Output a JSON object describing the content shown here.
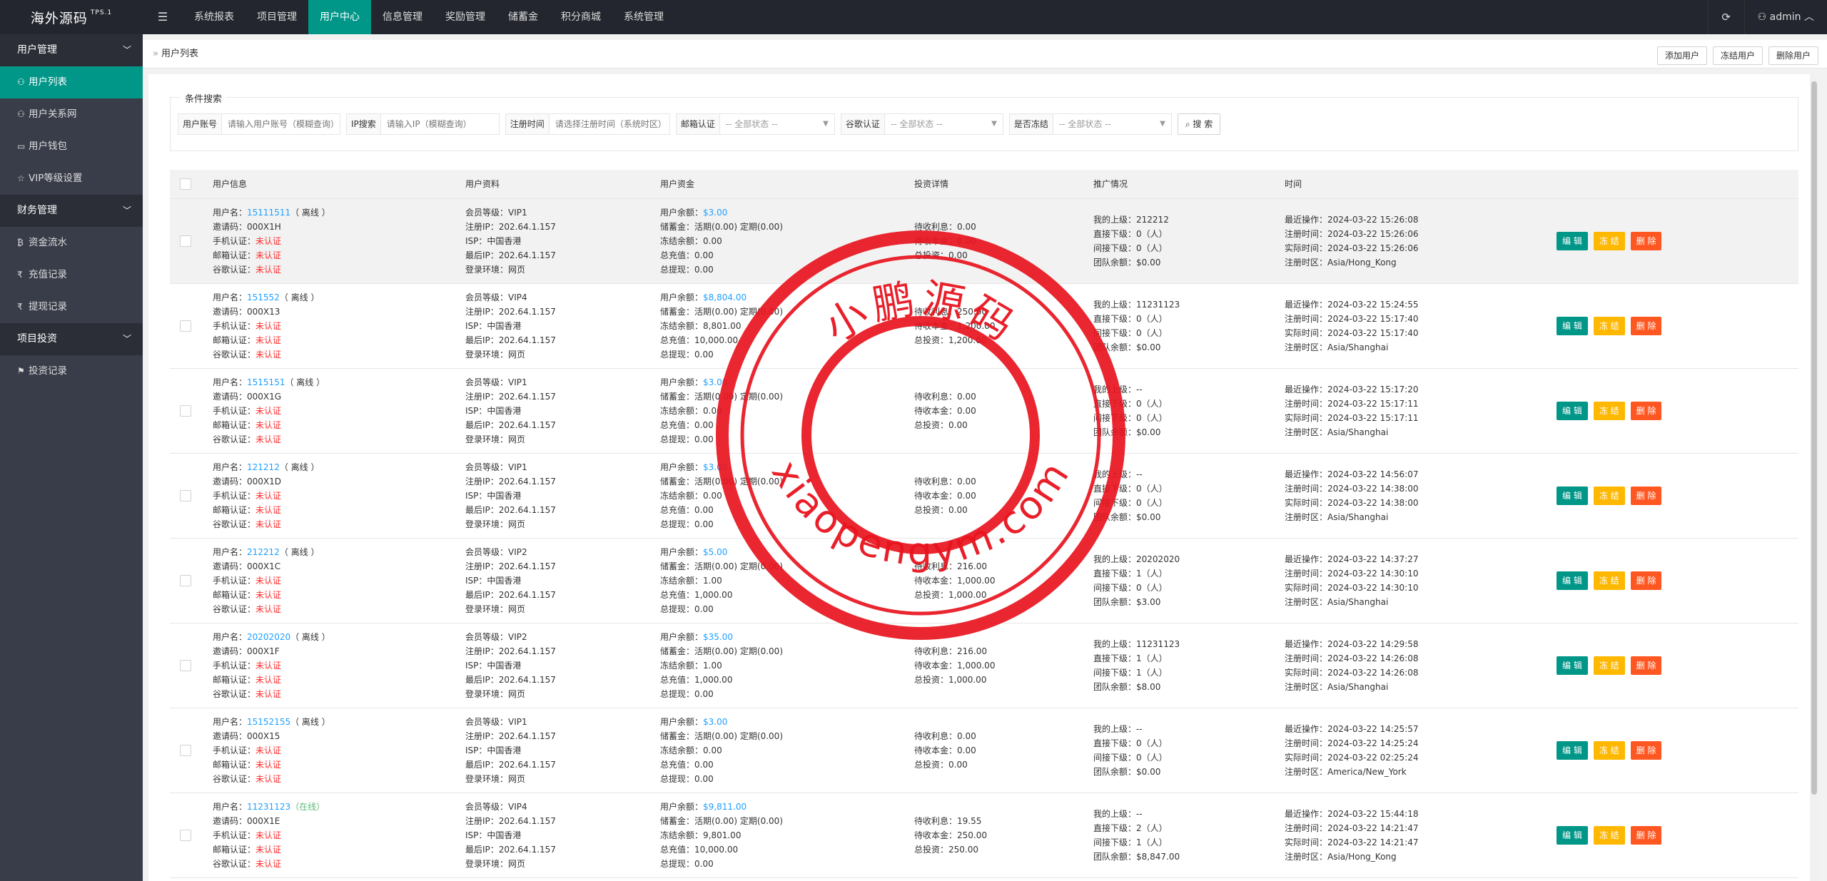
{
  "app": {
    "logo": "海外源码",
    "version": "TPS.1"
  },
  "topnav": {
    "menu_icon": "menu-icon",
    "items": [
      "系统报表",
      "项目管理",
      "用户中心",
      "信息管理",
      "奖励管理",
      "储蓄金",
      "积分商城",
      "系统管理"
    ],
    "active": "用户中心",
    "user": "admin",
    "refresh_icon": "refresh-icon"
  },
  "sidebar": {
    "groups": [
      {
        "label": "用户管理",
        "items": [
          {
            "label": "用户列表",
            "icon": "user-icon",
            "active": true
          },
          {
            "label": "用户关系网",
            "icon": "user-network-icon"
          },
          {
            "label": "用户钱包",
            "icon": "wallet-icon"
          },
          {
            "label": "VIP等级设置",
            "icon": "star-icon"
          }
        ]
      },
      {
        "label": "财务管理",
        "items": [
          {
            "label": "资金流水",
            "icon": "bitcoin-icon"
          },
          {
            "label": "充值记录",
            "icon": "rupee-icon"
          },
          {
            "label": "提现记录",
            "icon": "rupee-icon"
          }
        ]
      },
      {
        "label": "项目投资",
        "items": [
          {
            "label": "投资记录",
            "icon": "flag-icon"
          }
        ]
      }
    ]
  },
  "breadcrumb": {
    "sep": "»",
    "label": "用户列表"
  },
  "actions": {
    "add": "添加用户",
    "freeze": "冻结用户",
    "delete": "删除用户"
  },
  "search": {
    "legend": "条件搜索",
    "account": {
      "label": "用户账号",
      "placeholder": "请输入用户账号（模糊查询）"
    },
    "ip": {
      "label": "IP搜索",
      "placeholder": "请输入IP（模糊查询）"
    },
    "reg_time": {
      "label": "注册时间",
      "placeholder": "请选择注册时间（系统时区）"
    },
    "email_auth": {
      "label": "邮箱认证",
      "value": "-- 全部状态 --"
    },
    "google_auth": {
      "label": "谷歌认证",
      "value": "-- 全部状态 --"
    },
    "frozen": {
      "label": "是否冻结",
      "value": "-- 全部状态 --"
    },
    "button": "搜 索"
  },
  "table": {
    "headers": [
      "用户信息",
      "用户资料",
      "用户资金",
      "投资详情",
      "推广情况",
      "时间"
    ],
    "ops": {
      "edit": "编 辑",
      "freeze": "冻 结",
      "delete": "删 除"
    },
    "labels": {
      "username": "用户名：",
      "invite": "邀请码：",
      "phone": "手机认证：",
      "email": "邮箱认证：",
      "google": "谷歌认证：",
      "vip": "会员等级：",
      "reg_ip": "注册IP：",
      "isp": "ISP：",
      "last_ip": "最后IP：",
      "env": "登录环境：",
      "balance": "用户余额：",
      "savings": "储蓄金：",
      "frozen": "冻结余额：",
      "recharge": "总充值：",
      "withdraw": "总提现：",
      "pending_interest": "待收利息：",
      "pending_principal": "待收本金：",
      "total_invest": "总投资：",
      "superior": "我的上级：",
      "direct": "直接下级：",
      "indirect": "间接下级：",
      "team": "团队余额：",
      "last_op": "最近操作：",
      "reg_time": "注册时间：",
      "real_time": "实际时间：",
      "reg_tz": "注册时区："
    },
    "rows": [
      {
        "username": "15111511",
        "status": "（ 离线 ）",
        "online": false,
        "invite": "000X1H",
        "phone": "未认证",
        "email": "未认证",
        "google": "未认证",
        "vip": "VIP1",
        "reg_ip": "202.64.1.157",
        "isp": "中国香港",
        "last_ip": "202.64.1.157",
        "env": "网页",
        "balance": "$3.00",
        "savings": "活期(0.00) 定期(0.00)",
        "frozen": "0.00",
        "recharge": "0.00",
        "withdraw": "0.00",
        "pending_interest": "0.00",
        "pending_principal": "0.00",
        "total_invest": "0.00",
        "superior": "212212",
        "direct": "0（人）",
        "indirect": "0（人）",
        "team": "$0.00",
        "last_op": "2024-03-22 15:26:08",
        "reg_time": "2024-03-22 15:26:06",
        "real_time": "2024-03-22 15:26:06",
        "reg_tz": "Asia/Hong_Kong"
      },
      {
        "username": "151552",
        "status": "（ 离线 ）",
        "online": false,
        "invite": "000X13",
        "phone": "未认证",
        "email": "未认证",
        "google": "未认证",
        "vip": "VIP4",
        "reg_ip": "202.64.1.157",
        "isp": "中国香港",
        "last_ip": "202.64.1.157",
        "env": "网页",
        "balance": "$8,804.00",
        "savings": "活期(0.00) 定期(0.00)",
        "frozen": "8,801.00",
        "recharge": "10,000.00",
        "withdraw": "0.00",
        "pending_interest": "250.00",
        "pending_principal": "1,200.00",
        "total_invest": "1,200.00",
        "superior": "11231123",
        "direct": "0（人）",
        "indirect": "0（人）",
        "team": "$0.00",
        "last_op": "2024-03-22 15:24:55",
        "reg_time": "2024-03-22 15:17:40",
        "real_time": "2024-03-22 15:17:40",
        "reg_tz": "Asia/Shanghai"
      },
      {
        "username": "1515151",
        "status": "（ 离线 ）",
        "online": false,
        "invite": "000X1G",
        "phone": "未认证",
        "email": "未认证",
        "google": "未认证",
        "vip": "VIP1",
        "reg_ip": "202.64.1.157",
        "isp": "中国香港",
        "last_ip": "202.64.1.157",
        "env": "网页",
        "balance": "$3.00",
        "savings": "活期(0.00) 定期(0.00)",
        "frozen": "0.00",
        "recharge": "0.00",
        "withdraw": "0.00",
        "pending_interest": "0.00",
        "pending_principal": "0.00",
        "total_invest": "0.00",
        "superior": "--",
        "direct": "0（人）",
        "indirect": "0（人）",
        "team": "$0.00",
        "last_op": "2024-03-22 15:17:20",
        "reg_time": "2024-03-22 15:17:11",
        "real_time": "2024-03-22 15:17:11",
        "reg_tz": "Asia/Shanghai"
      },
      {
        "username": "121212",
        "status": "（ 离线 ）",
        "online": false,
        "invite": "000X1D",
        "phone": "未认证",
        "email": "未认证",
        "google": "未认证",
        "vip": "VIP1",
        "reg_ip": "202.64.1.157",
        "isp": "中国香港",
        "last_ip": "202.64.1.157",
        "env": "网页",
        "balance": "$3.00",
        "savings": "活期(0.00) 定期(0.00)",
        "frozen": "0.00",
        "recharge": "0.00",
        "withdraw": "0.00",
        "pending_interest": "0.00",
        "pending_principal": "0.00",
        "total_invest": "0.00",
        "superior": "--",
        "direct": "0（人）",
        "indirect": "0（人）",
        "team": "$0.00",
        "last_op": "2024-03-22 14:56:07",
        "reg_time": "2024-03-22 14:38:00",
        "real_time": "2024-03-22 14:38:00",
        "reg_tz": "Asia/Shanghai"
      },
      {
        "username": "212212",
        "status": "（ 离线 ）",
        "online": false,
        "invite": "000X1C",
        "phone": "未认证",
        "email": "未认证",
        "google": "未认证",
        "vip": "VIP2",
        "reg_ip": "202.64.1.157",
        "isp": "中国香港",
        "last_ip": "202.64.1.157",
        "env": "网页",
        "balance": "$5.00",
        "savings": "活期(0.00) 定期(0.00)",
        "frozen": "1.00",
        "recharge": "1,000.00",
        "withdraw": "0.00",
        "pending_interest": "216.00",
        "pending_principal": "1,000.00",
        "total_invest": "1,000.00",
        "superior": "20202020",
        "direct": "1（人）",
        "indirect": "0（人）",
        "team": "$3.00",
        "last_op": "2024-03-22 14:37:27",
        "reg_time": "2024-03-22 14:30:10",
        "real_time": "2024-03-22 14:30:10",
        "reg_tz": "Asia/Shanghai"
      },
      {
        "username": "20202020",
        "status": "（ 离线 ）",
        "online": false,
        "invite": "000X1F",
        "phone": "未认证",
        "email": "未认证",
        "google": "未认证",
        "vip": "VIP2",
        "reg_ip": "202.64.1.157",
        "isp": "中国香港",
        "last_ip": "202.64.1.157",
        "env": "网页",
        "balance": "$35.00",
        "savings": "活期(0.00) 定期(0.00)",
        "frozen": "1.00",
        "recharge": "1,000.00",
        "withdraw": "0.00",
        "pending_interest": "216.00",
        "pending_principal": "1,000.00",
        "total_invest": "1,000.00",
        "superior": "11231123",
        "direct": "1（人）",
        "indirect": "1（人）",
        "team": "$8.00",
        "last_op": "2024-03-22 14:29:58",
        "reg_time": "2024-03-22 14:26:08",
        "real_time": "2024-03-22 14:26:08",
        "reg_tz": "Asia/Shanghai"
      },
      {
        "username": "15152155",
        "status": "（ 离线 ）",
        "online": false,
        "invite": "000X15",
        "phone": "未认证",
        "email": "未认证",
        "google": "未认证",
        "vip": "VIP1",
        "reg_ip": "202.64.1.157",
        "isp": "中国香港",
        "last_ip": "202.64.1.157",
        "env": "网页",
        "balance": "$3.00",
        "savings": "活期(0.00) 定期(0.00)",
        "frozen": "0.00",
        "recharge": "0.00",
        "withdraw": "0.00",
        "pending_interest": "0.00",
        "pending_principal": "0.00",
        "total_invest": "0.00",
        "superior": "--",
        "direct": "0（人）",
        "indirect": "0（人）",
        "team": "$0.00",
        "last_op": "2024-03-22 14:25:57",
        "reg_time": "2024-03-22 14:25:24",
        "real_time": "2024-03-22 02:25:24",
        "reg_tz": "America/New_York"
      },
      {
        "username": "11231123",
        "status": "（在线）",
        "online": true,
        "invite": "000X1E",
        "phone": "未认证",
        "email": "未认证",
        "google": "未认证",
        "vip": "VIP4",
        "reg_ip": "202.64.1.157",
        "isp": "中国香港",
        "last_ip": "202.64.1.157",
        "env": "网页",
        "balance": "$9,811.00",
        "savings": "活期(0.00) 定期(0.00)",
        "frozen": "9,801.00",
        "recharge": "10,000.00",
        "withdraw": "0.00",
        "pending_interest": "19.55",
        "pending_principal": "250.00",
        "total_invest": "250.00",
        "superior": "--",
        "direct": "2（人）",
        "indirect": "1（人）",
        "team": "$8,847.00",
        "last_op": "2024-03-22 15:44:18",
        "reg_time": "2024-03-22 14:21:47",
        "real_time": "2024-03-22 14:21:47",
        "reg_tz": "Asia/Hong_Kong"
      }
    ]
  },
  "watermark": {
    "cn": "小鹏源码",
    "url": "xiaopengym.com",
    "color": "#e8141e"
  }
}
